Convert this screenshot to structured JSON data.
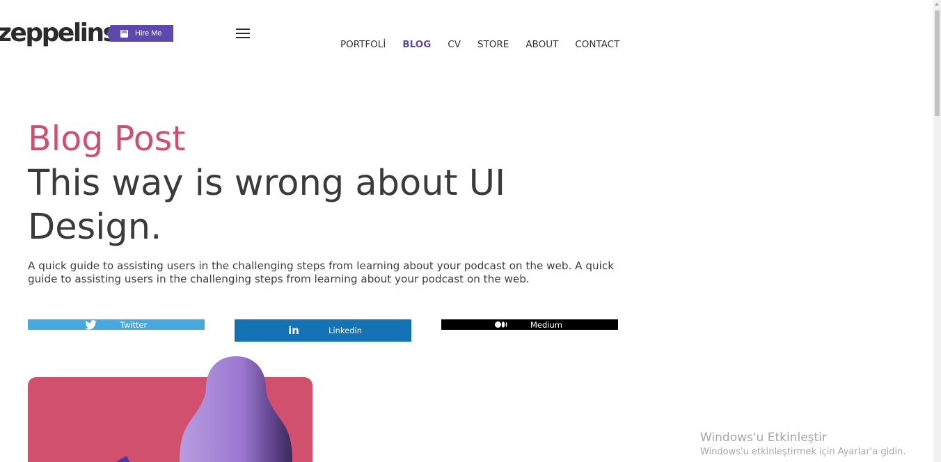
{
  "brand": {
    "logo_text": "zeppelins",
    "hire_label": "Hire Me",
    "accent": "#5b4aab"
  },
  "nav": {
    "items": [
      {
        "label": "PORTFOLİ",
        "active": false
      },
      {
        "label": "BLOG",
        "active": true
      },
      {
        "label": "CV",
        "active": false
      },
      {
        "label": "STORE",
        "active": false
      },
      {
        "label": "ABOUT",
        "active": false
      },
      {
        "label": "CONTACT",
        "active": false
      }
    ]
  },
  "post": {
    "kicker": "Blog Post",
    "title": "This way is wrong about UI Design.",
    "lede": "A quick guide to assisting users in the challenging steps from learning about your podcast on the web. A quick guide to assisting users in the challenging steps from learning about your podcast on the web.",
    "kicker_color": "#d04f6e"
  },
  "share": {
    "twitter": {
      "label": "Twitter",
      "color": "#45a9e0",
      "icon": "twitter-bird-icon"
    },
    "linkedin": {
      "label": "Linkedin",
      "color": "#1373b5",
      "icon": "linkedin-icon"
    },
    "medium": {
      "label": "Medium",
      "color": "#000000",
      "icon": "medium-icon"
    }
  },
  "hero": {
    "card_color": "#d0506e",
    "blob_color": "#a98bd6"
  },
  "windows_watermark": {
    "line1": "Windows'u Etkinleştir",
    "line2": "Windows'u etkinleştirmek için Ayarlar'a gidin."
  }
}
